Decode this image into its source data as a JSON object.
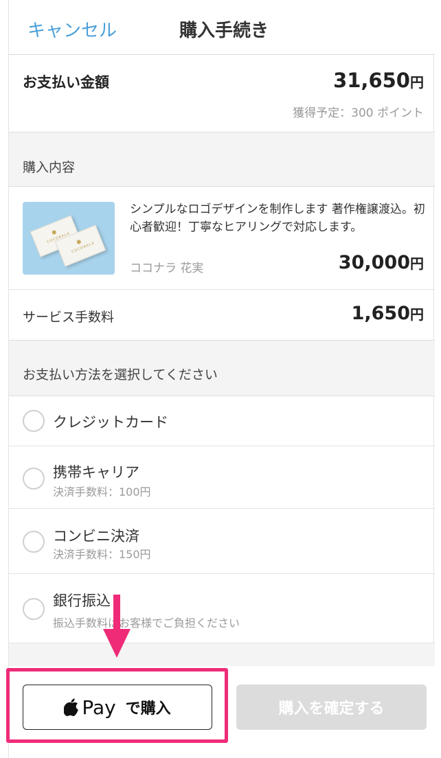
{
  "header": {
    "cancel_label": "キャンセル",
    "title": "購入手続き"
  },
  "total": {
    "label": "お支払い金額",
    "amount": "31,650",
    "currency": "円",
    "points": "獲得予定：300 ポイント"
  },
  "purchase_section": {
    "heading": "購入内容"
  },
  "product": {
    "description": "シンプルなロゴデザインを制作します 著作権譲渡込。初心者歓迎！丁寧なヒアリングで対応します。",
    "seller": "ココナラ 花実",
    "price": "30,000",
    "currency": "円",
    "thumbnail_text": "COCORALA"
  },
  "service_fee": {
    "label": "サービス手数料",
    "amount": "1,650",
    "currency": "円"
  },
  "payment_section": {
    "heading": "お支払い方法を選択してください"
  },
  "payment_options": [
    {
      "label": "クレジットカード",
      "sub": ""
    },
    {
      "label": "携帯キャリア",
      "sub": "決済手数料：100円"
    },
    {
      "label": "コンビニ決済",
      "sub": "決済手数料：150円"
    },
    {
      "label": "銀行振込",
      "sub": "振込手数料はお客様でご負担ください"
    }
  ],
  "bottom": {
    "apple_pay_word": "Pay",
    "apple_pay_suffix": "で購入",
    "confirm_label": "購入を確定する"
  },
  "colors": {
    "accent_link": "#4a9fd8",
    "highlight": "#ef2b78",
    "disabled_button": "#dcdcdc"
  }
}
